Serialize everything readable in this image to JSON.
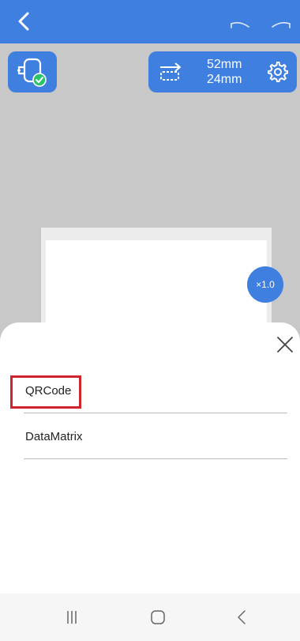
{
  "topbar": {
    "back_icon": "chevron-left-icon",
    "undo_icon": "undo-icon",
    "redo_icon": "redo-icon"
  },
  "toolbar": {
    "printer_icon": "printer-connected-icon",
    "size_icon": "swap-size-icon",
    "width": "52mm",
    "height": "24mm",
    "settings_icon": "gear-icon"
  },
  "canvas": {
    "zoom": "×1.0"
  },
  "barcode_type_sheet": {
    "options": [
      {
        "label": "QRCode",
        "highlighted": true
      },
      {
        "label": "DataMatrix",
        "highlighted": false
      }
    ],
    "close_icon": "close-icon"
  },
  "system_nav": {
    "recents_icon": "recents-icon",
    "home_icon": "home-icon",
    "back_icon": "back-icon"
  },
  "colors": {
    "accent": "#3f7fe0",
    "highlight": "#d0242c",
    "canvas_bg": "#c8c8c8"
  }
}
